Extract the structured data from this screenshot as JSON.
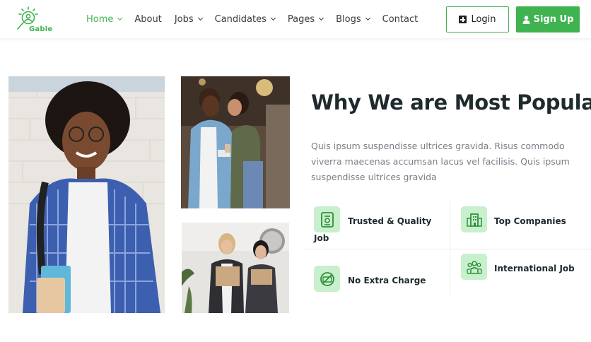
{
  "brand": {
    "name": "Gable",
    "accent": "#3fb34f",
    "icon_bg": "#c8f0cc"
  },
  "nav": {
    "items": [
      {
        "label": "Home",
        "dropdown": true,
        "active": true
      },
      {
        "label": "About",
        "dropdown": false,
        "active": false
      },
      {
        "label": "Jobs",
        "dropdown": true,
        "active": false
      },
      {
        "label": "Candidates",
        "dropdown": true,
        "active": false
      },
      {
        "label": "Pages",
        "dropdown": true,
        "active": false
      },
      {
        "label": "Blogs",
        "dropdown": true,
        "active": false
      },
      {
        "label": "Contact",
        "dropdown": false,
        "active": false
      }
    ]
  },
  "header": {
    "login_label": "Login",
    "signup_label": "Sign Up"
  },
  "section": {
    "title": "Why We are Most Popular",
    "description": "Quis ipsum suspendisse ultrices gravida. Risus commodo viverra maecenas accumsan lacus vel facilisis. Quis ipsum suspendisse ultrices gravida"
  },
  "features": [
    {
      "label_line1": "Trusted & Quality",
      "label_line2": "Job",
      "icon": "certificate-icon"
    },
    {
      "label_line1": "Top Companies",
      "icon": "building-icon"
    },
    {
      "label_line1": "No Extra Charge",
      "icon": "no-charge-icon"
    },
    {
      "label_line1": "International Job",
      "icon": "team-icon"
    }
  ]
}
